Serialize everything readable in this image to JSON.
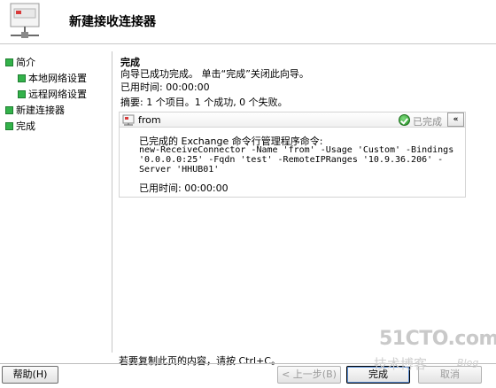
{
  "header": {
    "title": "新建接收连接器"
  },
  "nav": {
    "items": [
      {
        "label": "简介"
      },
      {
        "label": "本地网络设置"
      },
      {
        "label": "远程网络设置"
      },
      {
        "label": "新建连接器"
      },
      {
        "label": "完成"
      }
    ]
  },
  "main": {
    "section_title": "完成",
    "wizard_message": "向导已成功完成。 单击“完成”关闭此向导。",
    "elapsed": "已用时间: 00:00:00",
    "summary": "摘要: 1 个项目。1 个成功, 0 个失败。",
    "result": {
      "name": "from",
      "status": "已完成",
      "collapse_symbol": "«",
      "command_label": "已完成的 Exchange 命令行管理程序命令:",
      "command": "new-ReceiveConnector -Name 'from' -Usage 'Custom' -Bindings '0.0.0.0:25' -Fqdn 'test' -RemoteIPRanges '10.9.36.206' -Server 'HHUB01'",
      "elapsed": "已用时间: 00:00:00"
    },
    "copy_hint": "若要复制此页的内容，请按 Ctrl+C。"
  },
  "footer": {
    "help": "帮助(H)",
    "back": "< 上一步(B)",
    "finish": "完成",
    "cancel": "取消"
  },
  "watermark": {
    "main": "51CTO.com",
    "sub": "技术博客",
    "blog": "Blog"
  },
  "colors": {
    "nav_bullet": "#33b24a",
    "status_gray": "#8c8c8c"
  }
}
